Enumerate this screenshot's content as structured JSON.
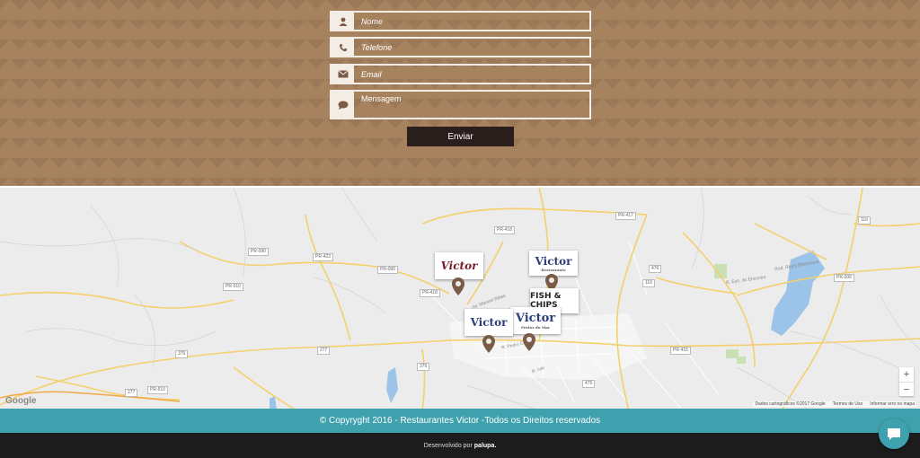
{
  "form": {
    "name_placeholder": "Nome",
    "phone_placeholder": "Telefone",
    "email_placeholder": "Email",
    "message_placeholder": "Mensagem",
    "submit_label": "Enviar"
  },
  "map": {
    "road_labels": [
      "PR-417",
      "PR-418",
      "PR-090",
      "PR-090",
      "PR-510",
      "PR-418",
      "376",
      "376",
      "277",
      "PR-510",
      "476",
      "116",
      "116",
      "PR-506",
      "476",
      "PR-415",
      "277",
      "PR-423"
    ],
    "street_labels": [
      "Av. Manoel Ribas",
      "R. Pedro Gusso",
      "R. Eyo. do Encontro",
      "Rod. Régis Bittencourt",
      "R. Ivaí"
    ],
    "restaurant_logos": [
      "Victor",
      "Victor",
      "FISH & CHIPS",
      "Victor",
      "Victor"
    ],
    "logo_subtitles": [
      "Restaurante",
      "Restaurante",
      "",
      "",
      "Frutos do Mar"
    ],
    "google_label": "Google",
    "attribution": "Dados cartográficos ©2017 Google",
    "terms": "Termos de Uso",
    "report": "Informar erro no mapa",
    "zoom_in": "+",
    "zoom_out": "−"
  },
  "footer": {
    "copyright": "© Copyryght 2016 - Restaurantes Victor -Todos os Direitos reservados",
    "developed_by": "Desenvolvido por",
    "developer": "palupa."
  },
  "colors": {
    "brown": "#a7825f",
    "teal": "#3fa1ad",
    "dark": "#1c1c1c",
    "pin": "#7b5a46"
  },
  "icons": [
    "user-icon",
    "phone-icon",
    "envelope-icon",
    "comment-icon",
    "chat-icon"
  ]
}
